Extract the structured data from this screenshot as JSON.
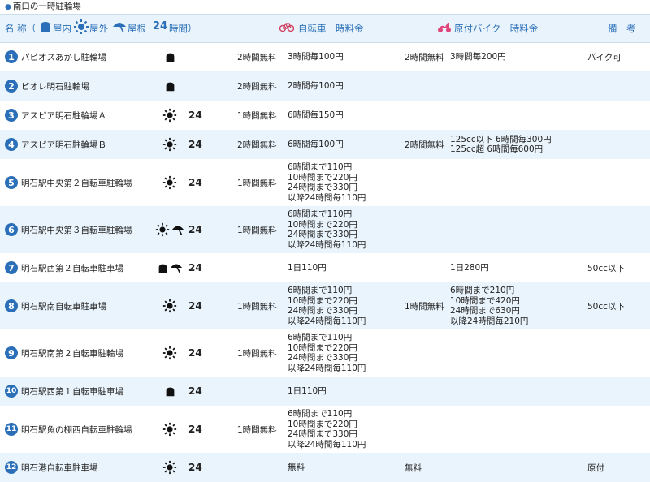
{
  "section_title": "南口の一時駐輪場",
  "header": {
    "name_label": "名 称（",
    "indoor": "屋内",
    "outdoor": "屋外",
    "roof": "屋根",
    "h24": "24",
    "hours": "時間）",
    "bicycle": "自転車一時料金",
    "moped": "原付バイク一時料金",
    "note": "備　考"
  },
  "colors": {
    "accent": "#2a6fb8",
    "row_alt": "#eaf4fc",
    "moped_icon": "#e0457b",
    "bike_icon": "#d04060"
  },
  "rows": [
    {
      "num": "1",
      "name": "パピオスあかし駐輪場",
      "icons": [
        "indoor"
      ],
      "h24": "",
      "bfree": "2時間無料",
      "bfee": [
        "3時間毎100円"
      ],
      "mfree": "2時間無料",
      "mfee": [
        "3時間毎200円"
      ],
      "note": "バイク可"
    },
    {
      "num": "2",
      "name": "ビオレ明石駐輪場",
      "icons": [
        "indoor"
      ],
      "h24": "",
      "bfree": "2時間無料",
      "bfee": [
        "2時間毎100円"
      ],
      "mfree": "",
      "mfee": [],
      "note": ""
    },
    {
      "num": "3",
      "name": "アスピア明石駐輪場Ａ",
      "icons": [
        "outdoor"
      ],
      "h24": "24",
      "bfree": "1時間無料",
      "bfee": [
        "6時間毎150円"
      ],
      "mfree": "",
      "mfee": [],
      "note": ""
    },
    {
      "num": "4",
      "name": "アスピア明石駐輪場Ｂ",
      "icons": [
        "outdoor"
      ],
      "h24": "24",
      "bfree": "2時間無料",
      "bfee": [
        "6時間毎100円"
      ],
      "mfree": "2時間無料",
      "mfee": [
        "125cc以下 6時間毎300円",
        "125cc超 6時間毎600円"
      ],
      "note": ""
    },
    {
      "num": "5",
      "name": "明石駅中央第２自転車駐輪場",
      "icons": [
        "outdoor"
      ],
      "h24": "24",
      "bfree": "1時間無料",
      "bfee": [
        "6時間まで110円",
        "10時間まで220円",
        "24時間まで330円",
        "以降24時間毎110円"
      ],
      "mfree": "",
      "mfee": [],
      "note": ""
    },
    {
      "num": "6",
      "name": "明石駅中央第３自転車駐輪場",
      "icons": [
        "outdoor",
        "roof"
      ],
      "h24": "24",
      "bfree": "1時間無料",
      "bfee": [
        "6時間まで110円",
        "10時間まで220円",
        "24時間まで330円",
        "以降24時間毎110円"
      ],
      "mfree": "",
      "mfee": [],
      "note": ""
    },
    {
      "num": "7",
      "name": "明石駅西第２自転車駐車場",
      "icons": [
        "indoor",
        "roof"
      ],
      "h24": "24",
      "bfree": "",
      "bfee": [
        "1日110円"
      ],
      "mfree": "",
      "mfee": [
        "1日280円"
      ],
      "note": "50cc以下"
    },
    {
      "num": "8",
      "name": "明石駅南自転車駐車場",
      "icons": [
        "outdoor"
      ],
      "h24": "24",
      "bfree": "1時間無料",
      "bfee": [
        "6時間まで110円",
        "10時間まで220円",
        "24時間まで330円",
        "以降24時間毎110円"
      ],
      "mfree": "1時間無料",
      "mfee": [
        "6時間まで210円",
        "10時間まで420円",
        "24時間まで630円",
        "以降24時間毎210円"
      ],
      "note": "50cc以下"
    },
    {
      "num": "9",
      "name": "明石駅南第２自転車駐輪場",
      "icons": [
        "outdoor"
      ],
      "h24": "24",
      "bfree": "1時間無料",
      "bfee": [
        "6時間まで110円",
        "10時間まで220円",
        "24時間まで330円",
        "以降24時間毎110円"
      ],
      "mfree": "",
      "mfee": [],
      "note": ""
    },
    {
      "num": "10",
      "name": "明石駅西第１自転車駐車場",
      "icons": [
        "indoor"
      ],
      "h24": "24",
      "bfree": "",
      "bfee": [
        "1日110円"
      ],
      "mfree": "",
      "mfee": [],
      "note": ""
    },
    {
      "num": "11",
      "name": "明石駅魚の棚西自転車駐輪場",
      "icons": [
        "outdoor"
      ],
      "h24": "24",
      "bfree": "1時間無料",
      "bfee": [
        "6時間まで110円",
        "10時間まで220円",
        "24時間まで330円",
        "以降24時間毎110円"
      ],
      "mfree": "",
      "mfee": [],
      "note": ""
    },
    {
      "num": "12",
      "name": "明石港自転車駐車場",
      "icons": [
        "outdoor"
      ],
      "h24": "24",
      "bfree": "",
      "bfee": [
        "無料"
      ],
      "mfree": "無料",
      "mfee": [],
      "note": "原付"
    }
  ]
}
